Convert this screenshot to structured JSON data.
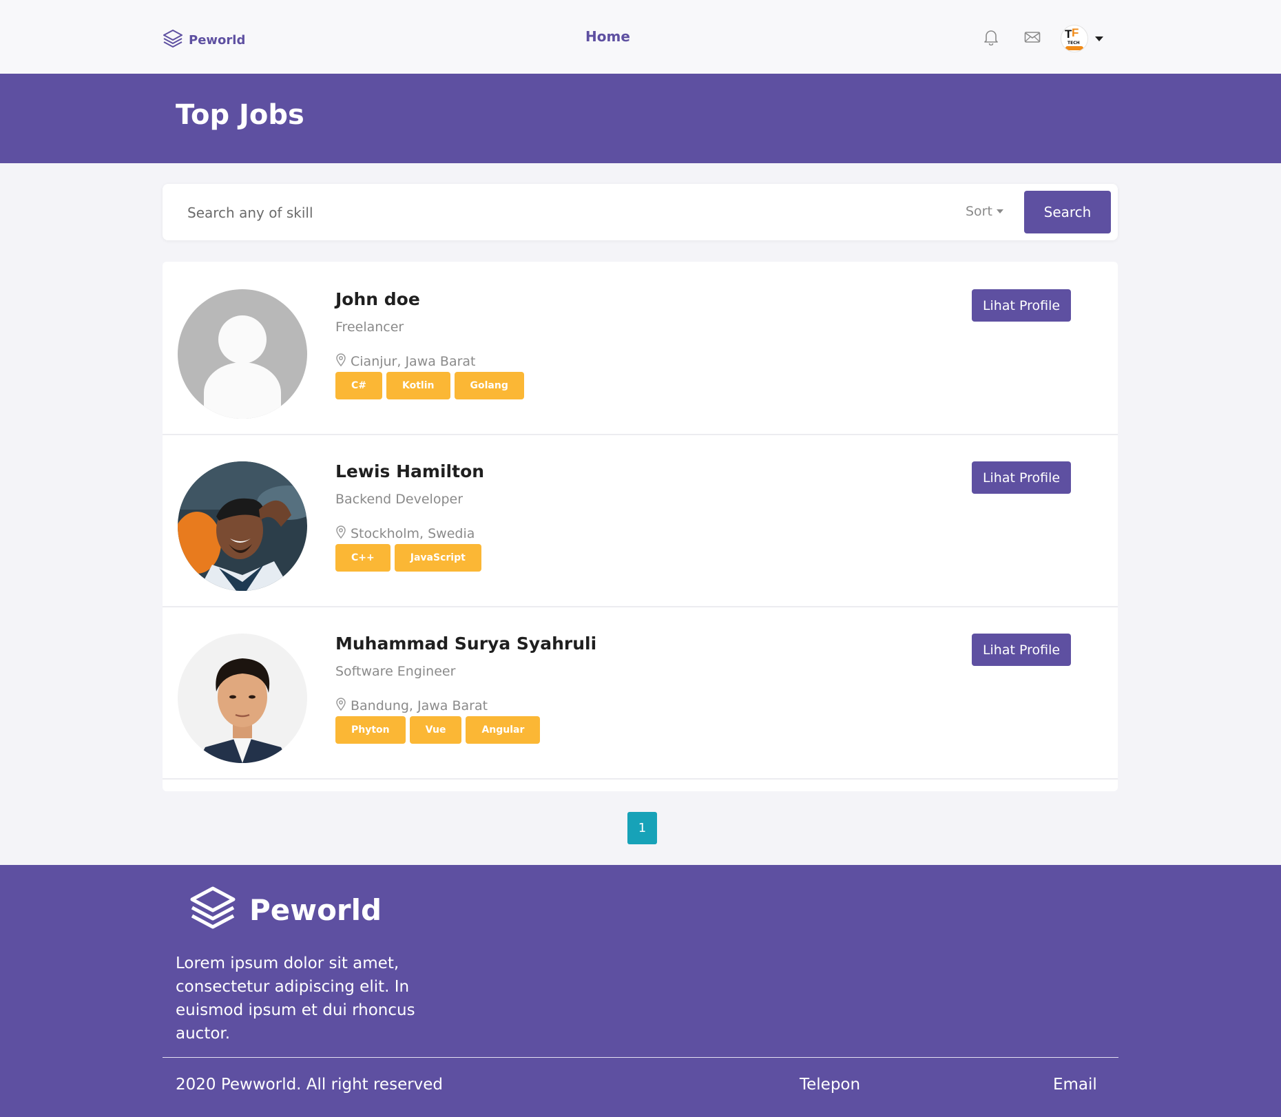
{
  "navbar": {
    "brand": "Peworld",
    "home_label": "Home",
    "icons": [
      "layers-logo-icon",
      "bell-icon",
      "mail-icon",
      "avatar",
      "caret-down-icon"
    ],
    "avatar_text": {
      "t": "T",
      "f": "F",
      "tech": "TECH"
    }
  },
  "hero": {
    "title": "Top Jobs"
  },
  "search": {
    "placeholder": "Search any of skill",
    "sort_label": "Sort",
    "button_label": "Search"
  },
  "profiles": [
    {
      "name": "John doe",
      "role": "Freelancer",
      "location": "Cianjur, Jawa Barat",
      "skills": [
        "C#",
        "Kotlin",
        "Golang"
      ],
      "button_label": "Lihat Profile"
    },
    {
      "name": "Lewis Hamilton",
      "role": "Backend Developer",
      "location": "Stockholm, Swedia",
      "skills": [
        "C++",
        "JavaScript"
      ],
      "button_label": "Lihat Profile"
    },
    {
      "name": "Muhammad Surya Syahruli",
      "role": "Software Engineer",
      "location": "Bandung, Jawa Barat",
      "skills": [
        "Phyton",
        "Vue",
        "Angular"
      ],
      "button_label": "Lihat Profile"
    }
  ],
  "pagination": {
    "current_page": "1"
  },
  "footer": {
    "brand": "Peworld",
    "description": "Lorem ipsum dolor sit amet, consectetur adipiscing elit. In euismod ipsum et dui rhoncus auctor.",
    "copyright": "2020 Pewworld. All right reserved",
    "telepon_label": "Telepon",
    "email_label": "Email"
  },
  "colors": {
    "primary": "#5e50a1",
    "skill_badge": "#fbb735",
    "pagination_active": "#17a2b8",
    "background": "#f4f4f8"
  }
}
